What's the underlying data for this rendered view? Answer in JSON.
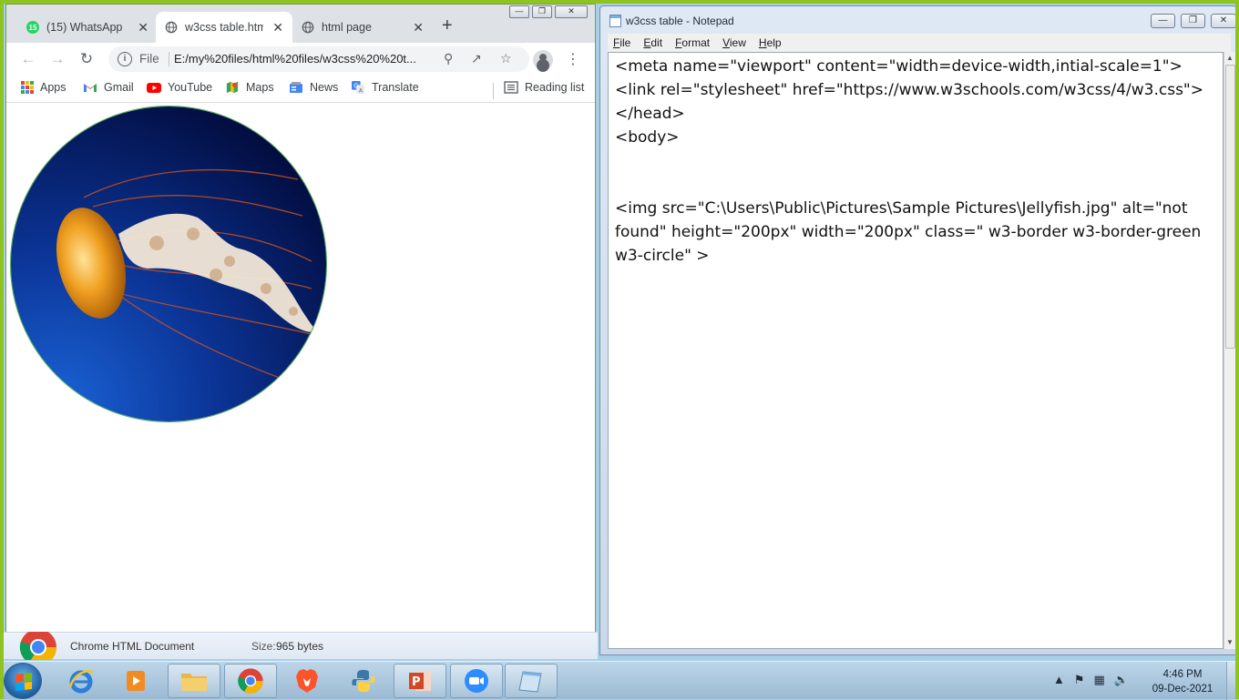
{
  "explorer_status": {
    "type_label": "Chrome HTML Document",
    "size_label": "Size:",
    "size_value": "965 bytes"
  },
  "chrome": {
    "tabs": [
      {
        "label": "(15) WhatsApp",
        "badge": "15",
        "icon": "whatsapp-icon"
      },
      {
        "label": "w3css  table.html",
        "icon": "globe-icon",
        "active": true
      },
      {
        "label": "html page",
        "icon": "globe-icon"
      }
    ],
    "address": {
      "scheme": "File",
      "url": "E:/my%20files/html%20files/w3css%20%20t..."
    },
    "bookmarks": [
      {
        "label": "Apps",
        "icon": "apps-grid-icon"
      },
      {
        "label": "Gmail",
        "icon": "gmail-icon"
      },
      {
        "label": "YouTube",
        "icon": "youtube-icon"
      },
      {
        "label": "Maps",
        "icon": "maps-icon"
      },
      {
        "label": "News",
        "icon": "news-icon"
      },
      {
        "label": "Translate",
        "icon": "translate-icon"
      }
    ],
    "reading_list": "Reading list",
    "image_alt": "Jellyfish"
  },
  "notepad": {
    "title": "w3css  table - Notepad",
    "menu": [
      "File",
      "Edit",
      "Format",
      "View",
      "Help"
    ],
    "content": "<meta name=\"viewport\" content=\"width=device-width,intial-scale=1\">\n<link rel=\"stylesheet\" href=\"https://www.w3schools.com/w3css/4/w3.css\">\n</head>\n<body>\n\n\n<img src=\"C:\\Users\\Public\\Pictures\\Sample Pictures\\Jellyfish.jpg\" alt=\"not found\" height=\"200px\" width=\"200px\" class=\" w3-border w3-border-green w3-circle\" >"
  },
  "taskbar": {
    "apps": [
      "internet-explorer-icon",
      "media-player-icon",
      "file-explorer-icon",
      "chrome-icon",
      "brave-icon",
      "python-icon",
      "powerpoint-icon",
      "zoom-icon",
      "notepad-icon"
    ],
    "time": "4:46 PM",
    "date": "09-Dec-2021"
  },
  "colors": {
    "frame_green": "#8fc31f",
    "taskbar": "#a9c7e0",
    "chrome_tabstrip": "#dee1e6",
    "image_border": "#4caf50"
  }
}
